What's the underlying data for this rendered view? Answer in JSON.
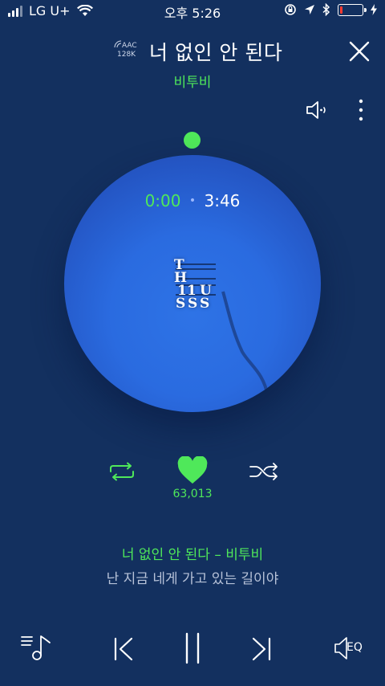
{
  "status_bar": {
    "carrier": "LG U+",
    "time": "오후 5:26"
  },
  "header": {
    "codec_format": "AAC",
    "codec_bitrate": "128K",
    "song_title": "너 없인 안 된다",
    "artist": "비투비"
  },
  "player": {
    "current_time": "0:00",
    "separator": "•",
    "total_time": "3:46",
    "progress": 0,
    "album_logo_letters": [
      "T",
      "H",
      "1",
      "1",
      "U",
      "S",
      "S",
      "S"
    ]
  },
  "actions": {
    "like_count": "63,013"
  },
  "lyrics": {
    "heading": "너 없인 안 된다 – 비투비",
    "line": "난 지금 네게 가고 있는 길이야"
  },
  "controls": {
    "eq_label": "EQ"
  },
  "colors": {
    "background": "#13305f",
    "accent": "#4fe85a",
    "disc": "#2a6be0"
  },
  "icons": [
    "wifi-icon",
    "location-icon",
    "bluetooth-icon",
    "battery-icon",
    "close-icon",
    "speaker-icon",
    "more-icon",
    "repeat-icon",
    "heart-icon",
    "shuffle-icon",
    "playlist-icon",
    "previous-icon",
    "pause-icon",
    "next-icon",
    "eq-icon"
  ]
}
